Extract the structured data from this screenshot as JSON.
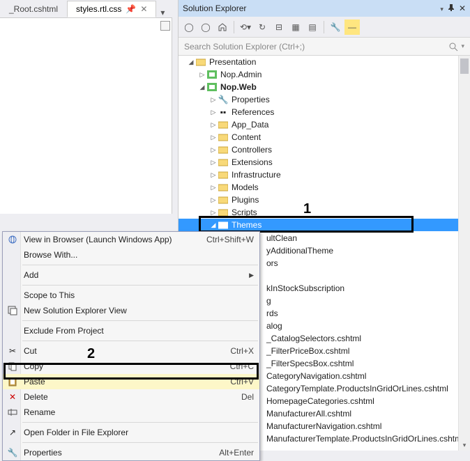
{
  "tabs": {
    "items": [
      {
        "label": "_Root.cshtml",
        "active": false
      },
      {
        "label": "styles.rtl.css",
        "active": true
      }
    ]
  },
  "panel": {
    "title": "Solution Explorer"
  },
  "search": {
    "placeholder": "Search Solution Explorer (Ctrl+;)"
  },
  "tree": {
    "presentation": "Presentation",
    "nop_admin": "Nop.Admin",
    "nop_web": "Nop.Web",
    "properties": "Properties",
    "references": "References",
    "app_data": "App_Data",
    "content": "Content",
    "controllers": "Controllers",
    "extensions": "Extensions",
    "infrastructure": "Infrastructure",
    "models": "Models",
    "plugins": "Plugins",
    "scripts": "Scripts",
    "themes": "Themes",
    "partial_items": [
      "ultClean",
      "yAdditionalTheme",
      "ors",
      "",
      "kInStockSubscription",
      "g",
      "rds",
      "alog",
      "_CatalogSelectors.cshtml",
      "_FilterPriceBox.cshtml",
      "_FilterSpecsBox.cshtml",
      "CategoryNavigation.cshtml",
      "CategoryTemplate.ProductsInGridOrLines.cshtml",
      "HomepageCategories.cshtml",
      "ManufacturerAll.cshtml",
      "ManufacturerNavigation.cshtml",
      "ManufacturerTemplate.ProductsInGridOrLines.cshtm"
    ]
  },
  "context_menu": {
    "view_browser": "View in Browser (Launch Windows App)",
    "view_browser_kb": "Ctrl+Shift+W",
    "browse_with": "Browse With...",
    "add": "Add",
    "scope": "Scope to This",
    "new_view": "New Solution Explorer View",
    "exclude": "Exclude From Project",
    "cut": "Cut",
    "cut_kb": "Ctrl+X",
    "copy": "Copy",
    "copy_kb": "Ctrl+C",
    "paste": "Paste",
    "paste_kb": "Ctrl+V",
    "delete": "Delete",
    "delete_kb": "Del",
    "rename": "Rename",
    "open_folder": "Open Folder in File Explorer",
    "properties": "Properties",
    "properties_kb": "Alt+Enter"
  },
  "annotations": {
    "label1": "1",
    "label2": "2"
  }
}
